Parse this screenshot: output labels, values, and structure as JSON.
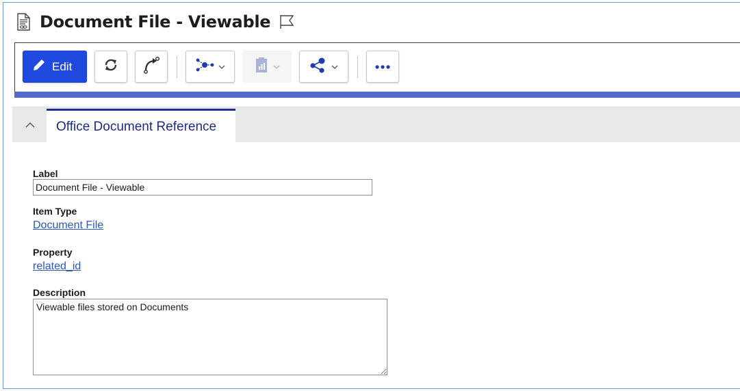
{
  "header": {
    "title": "Document File - Viewable",
    "title_icon": "document-link-icon",
    "flag_icon": "flag-icon"
  },
  "toolbar": {
    "edit_label": "Edit",
    "buttons": [
      {
        "name": "edit-button",
        "icon": "pencil-icon"
      },
      {
        "name": "refresh-button",
        "icon": "refresh-icon"
      },
      {
        "name": "workflow-button",
        "icon": "curved-arrow-icon"
      },
      {
        "name": "structure-button",
        "icon": "network-icon",
        "has_dropdown": true
      },
      {
        "name": "reports-button",
        "icon": "clipboard-chart-icon",
        "has_dropdown": true,
        "disabled": true
      },
      {
        "name": "share-button",
        "icon": "share-icon",
        "has_dropdown": true
      },
      {
        "name": "more-button",
        "icon": "more-horizontal-icon"
      }
    ],
    "accent_color": "#2049e0",
    "bar_color": "#5569c9"
  },
  "tabs": [
    {
      "label": "Office Document Reference",
      "active": true
    }
  ],
  "form": {
    "label": {
      "caption": "Label",
      "value": "Document File - Viewable"
    },
    "item_type": {
      "caption": "Item Type",
      "value": "Document File"
    },
    "property": {
      "caption": "Property",
      "value": "related_id"
    },
    "description": {
      "caption": "Description",
      "value": "Viewable files stored on Documents"
    }
  }
}
